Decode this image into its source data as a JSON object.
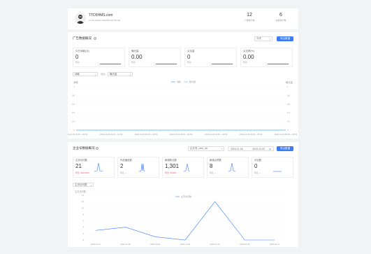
{
  "profile": {
    "name": "TTD5HMS.com",
    "subtitle": "ceYHr.d1ghh.eGkO5GT@Y5d.dal",
    "stats": [
      {
        "value": "12",
        "label": "广告账户数"
      },
      {
        "value": "6",
        "label": "在投账户数"
      }
    ]
  },
  "ad_section": {
    "title": "广告数据概况",
    "help_icon": "help-circle-icon",
    "range_select": "今天",
    "action_button": "导出数据",
    "metrics": [
      {
        "title": "今日消耗(元)",
        "value": "0",
        "compare": "环比 --"
      },
      {
        "title": "曝光量",
        "value": "0.00",
        "compare": "环比 --"
      },
      {
        "title": "点击量",
        "value": "0",
        "compare": "环比 --"
      },
      {
        "title": "点击率(%)",
        "value": "0.00",
        "compare": "环比 --"
      }
    ],
    "filter1": "消耗",
    "filter_vs": "对比",
    "filter2": "曝光量",
    "chart_data": {
      "type": "line",
      "ylabel_left": "消耗",
      "ylabel_right": "曝光量",
      "legend": [
        "消耗",
        "曝光量"
      ],
      "yticks": [
        "1",
        "0.8",
        "0.6",
        "0.4",
        "0.2",
        "0"
      ],
      "x": [
        "2024-12-03 00:00 ~ 00:59",
        "2024-12-03 01:00 ~ 01:59",
        "2024-12-03 02:00 ~ 02:59",
        "2024-12-03 03:00 ~ 03:59",
        "2024-12-03 04:00 ~ 04:59",
        "2024-12-03 05:00 ~ 05:59",
        "2024-12-03 06:00 ~ 06:59"
      ],
      "series": [
        {
          "name": "消耗",
          "values": [
            0,
            0,
            0,
            0,
            0,
            0,
            0
          ]
        },
        {
          "name": "曝光量",
          "values": [
            0,
            0,
            0,
            0,
            0,
            0,
            0
          ]
        }
      ],
      "ylim": [
        0,
        1
      ]
    }
  },
  "corp_section": {
    "title": "企业号数据概况",
    "account_select": "企业号_cool_ua",
    "date_from": "2024-11-18",
    "date_to": "2024-12-02",
    "action_button": "导出数据",
    "metrics": [
      {
        "title": "主页访问数",
        "value": "21",
        "compare": "环比 -100.00%"
      },
      {
        "title": "作品播放数",
        "value": "2",
        "compare": "环比 --"
      },
      {
        "title": "新增粉丝数",
        "value": "1,301",
        "compare": "环比 -6.66%"
      },
      {
        "title": "新增点赞数",
        "value": "8",
        "compare": "环比 --"
      },
      {
        "title": "评论数",
        "value": "0",
        "compare": "环比 --"
      }
    ],
    "metric_select": "主页访问数",
    "chart_data": {
      "type": "line",
      "title": "主页访问数",
      "legend": [
        "主页访问数"
      ],
      "yticks": [
        "14",
        "12",
        "10",
        "8",
        "6",
        "4",
        "2",
        "0"
      ],
      "ylim": [
        0,
        14
      ],
      "x": [
        "2024-12-11",
        "2024-12-16",
        "2024-12-21",
        "2024-12-26",
        "2025-01-01",
        "2025-01-06",
        "2025-01-11"
      ],
      "series": [
        {
          "name": "主页访问数",
          "values": [
            3,
            4,
            1,
            0,
            12,
            0,
            0
          ]
        }
      ]
    }
  }
}
